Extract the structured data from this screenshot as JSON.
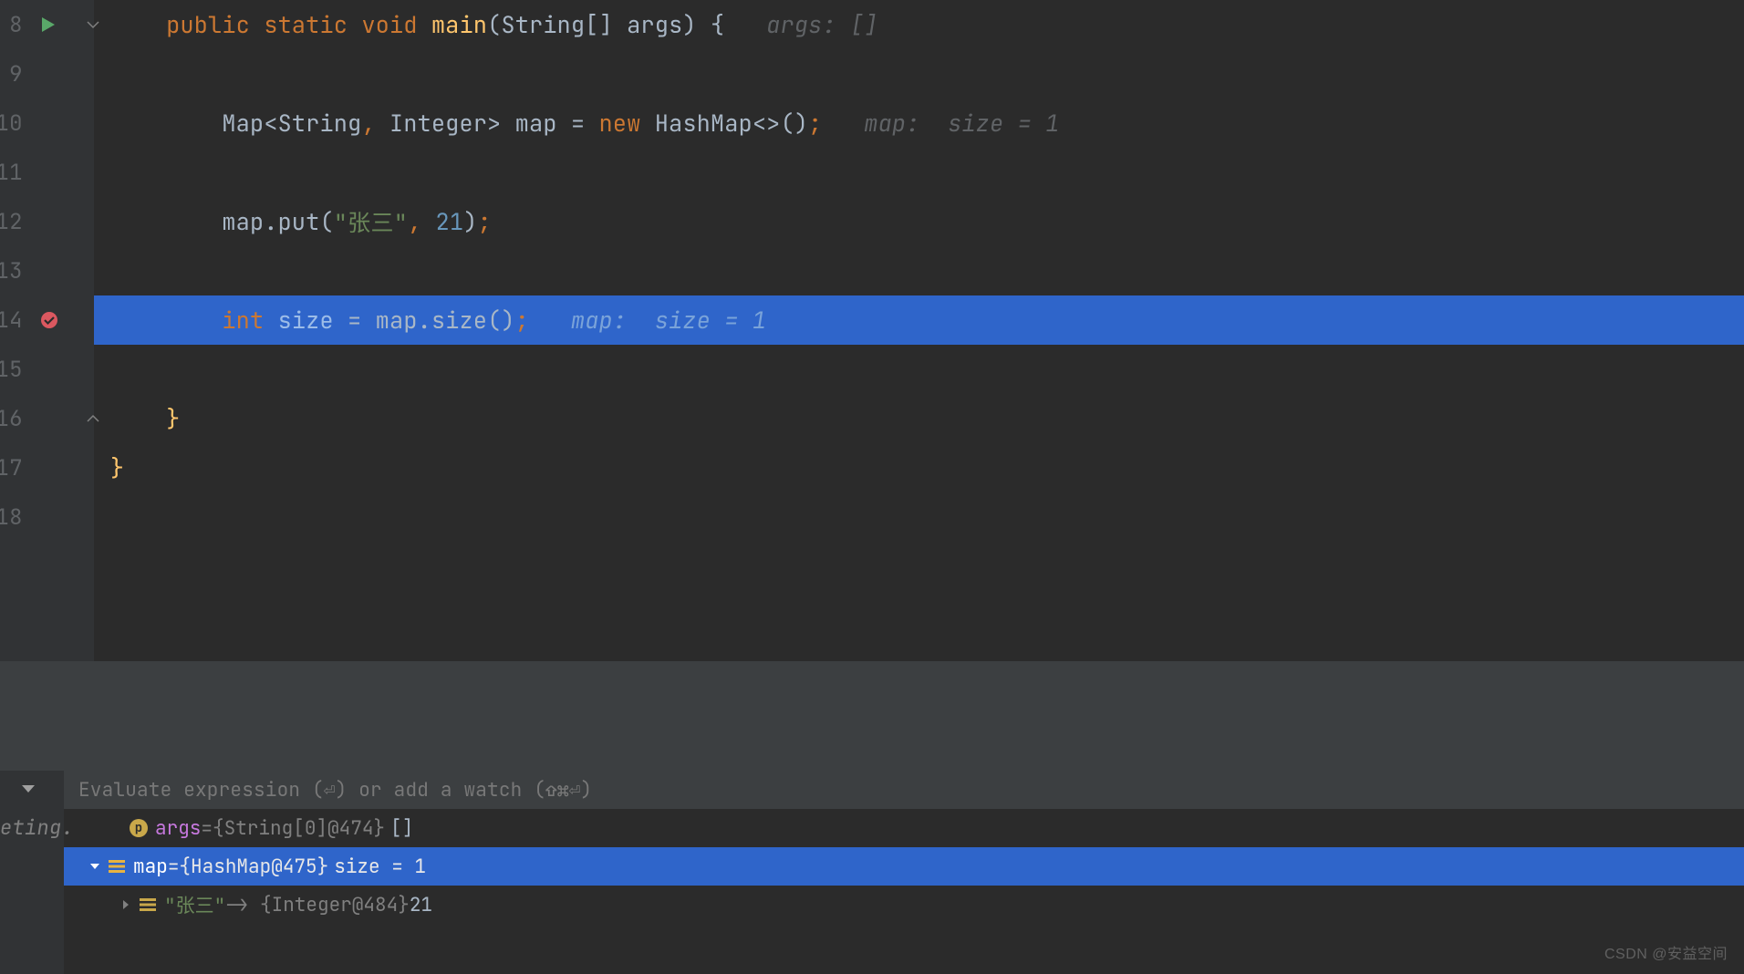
{
  "gutter": {
    "lines": [
      "8",
      "9",
      "10",
      "11",
      "12",
      "13",
      "14",
      "15",
      "16",
      "17",
      "18"
    ],
    "run_line_index": 0,
    "breakpoint_line_index": 6,
    "fold_start_index": 0,
    "fold_end_index": 8
  },
  "code": {
    "l8": {
      "kw1": "public",
      "kw2": "static",
      "kw3": "void",
      "m": "main",
      "p1": "(",
      "t": "String",
      "br": "[]",
      "arg": "args",
      "p2": ")",
      "ob": "{",
      "hint": "args: []"
    },
    "l10": {
      "t1": "Map",
      "lt": "<",
      "t2": "String",
      "t3": "Integer",
      "gt": ">",
      "id": "map",
      "eq": "=",
      "kw": "new",
      "tN": "HashMap",
      "dia": "<>",
      "par": "()",
      "sc": ";",
      "hint": "map:  size = 1"
    },
    "l12": {
      "id": "map",
      "dot": ".",
      "m": "put",
      "p1": "(",
      "s": "\"张三\"",
      "c": ",",
      "n": "21",
      "p2": ")",
      "sc": ";"
    },
    "l14": {
      "kw": "int",
      "id": "size",
      "eq": "=",
      "obj": "map",
      "dot": ".",
      "m": "size",
      "par": "()",
      "sc": ";",
      "hint": "map:  size = 1"
    },
    "l16": {
      "cb": "}"
    },
    "l17": {
      "cb": "}"
    }
  },
  "debug": {
    "eval_placeholder": "Evaluate expression (⏎) or add a watch (⇧⌘⏎)",
    "side_label": "eting.",
    "vars": [
      {
        "icon": "p",
        "name": "args",
        "eq": " = ",
        "val": "{String[0]@474} ",
        "extra": "[]",
        "indent": 44,
        "arrow": "none",
        "sel": false
      },
      {
        "icon": "list",
        "name": "map",
        "eq": " = ",
        "val": "{HashMap@475} ",
        "extra": "size = 1",
        "indent": 20,
        "arrow": "down",
        "sel": true
      },
      {
        "icon": "list",
        "key": "\"张三\"",
        "mid": " -> {Integer@484} ",
        "extra": "21",
        "indent": 54,
        "arrow": "right",
        "sel": false
      }
    ]
  },
  "watermark": "CSDN @安益空间"
}
